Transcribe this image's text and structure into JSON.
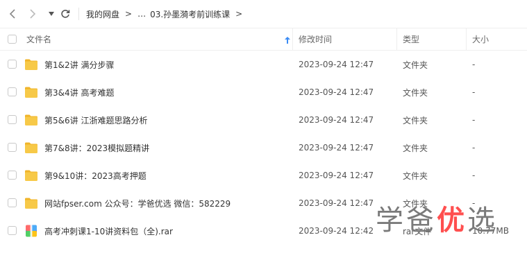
{
  "breadcrumb": {
    "root": "我的网盘",
    "sep": ">",
    "ellipsis": "…",
    "current": "03.孙墨漪考前训练课",
    "tail_sep": ">"
  },
  "columns": {
    "name": "文件名",
    "modified": "修改时间",
    "type": "类型",
    "size": "大小"
  },
  "files": [
    {
      "name": "第1&2讲 满分步骤",
      "modified": "2023-09-24 12:47",
      "type": "文件夹",
      "size": "-",
      "icon": "folder-icon"
    },
    {
      "name": "第3&4讲 高考难题",
      "modified": "2023-09-24 12:47",
      "type": "文件夹",
      "size": "-",
      "icon": "folder-icon"
    },
    {
      "name": "第5&6讲 江浙难题思路分析",
      "modified": "2023-09-24 12:47",
      "type": "文件夹",
      "size": "-",
      "icon": "folder-icon"
    },
    {
      "name": "第7&8讲：2023模拟题精讲",
      "modified": "2023-09-24 12:47",
      "type": "文件夹",
      "size": "-",
      "icon": "folder-icon"
    },
    {
      "name": "第9&10讲：2023高考押题",
      "modified": "2023-09-24 12:47",
      "type": "文件夹",
      "size": "-",
      "icon": "folder-icon"
    },
    {
      "name": "网站fpser.com 公众号：学爸优选 微信：582229",
      "modified": "2023-09-24 12:47",
      "type": "文件夹",
      "size": "-",
      "icon": "folder-icon"
    },
    {
      "name": "高考冲刺课1-10讲资料包（全).rar",
      "modified": "2023-09-24 12:42",
      "type": "rar文件",
      "size": "10.77MB",
      "icon": "rar-archive-icon"
    }
  ],
  "watermark": {
    "a": "学爸",
    "b": "优",
    "c": "选"
  },
  "colors": {
    "folder": "#f7c948",
    "folder_tab": "#f0b429",
    "sort_arrow": "#3b8cf5",
    "watermark_accent": "#ff4f4f"
  }
}
